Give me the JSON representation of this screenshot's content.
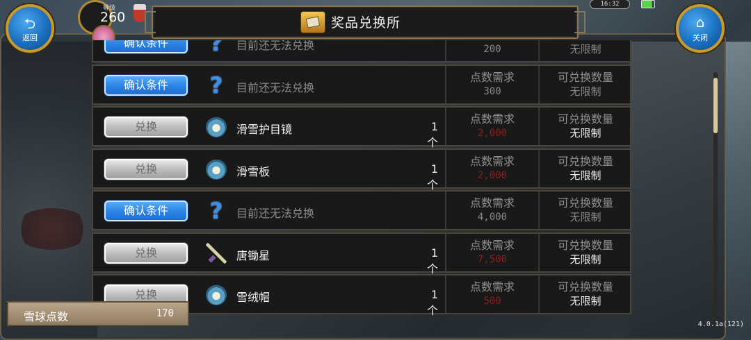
{
  "header": {
    "title": "奖品兑换所",
    "back_label": "返回",
    "close_label": "关闭",
    "level_caption": "等级",
    "level_value": "260",
    "time": "16:32"
  },
  "columns": {
    "need_header": "点数需求",
    "limit_header": "可兑换数量"
  },
  "rows": [
    {
      "action": "确认条件",
      "action_style": "blue",
      "icon": "question-icon",
      "name": "目前还无法兑换",
      "qty": "",
      "points": "200",
      "limit": "无限制",
      "available": false
    },
    {
      "action": "确认条件",
      "action_style": "blue",
      "icon": "question-icon",
      "name": "目前还无法兑换",
      "qty": "",
      "points": "300",
      "limit": "无限制",
      "available": false
    },
    {
      "action": "兑换",
      "action_style": "gray",
      "icon": "skate-shoe-icon",
      "name": "滑雪护目镜",
      "qty": "1个",
      "points": "2,000",
      "limit": "无限制",
      "available": true
    },
    {
      "action": "兑换",
      "action_style": "gray",
      "icon": "skate-shoe-icon",
      "name": "滑雪板",
      "qty": "1个",
      "points": "2,000",
      "limit": "无限制",
      "available": true
    },
    {
      "action": "确认条件",
      "action_style": "blue",
      "icon": "question-icon",
      "name": "目前还无法兑换",
      "qty": "",
      "points": "4,000",
      "limit": "无限制",
      "available": false
    },
    {
      "action": "兑换",
      "action_style": "gray",
      "icon": "sword-icon",
      "name": "唐锄星",
      "qty": "1个",
      "points": "7,500",
      "limit": "无限制",
      "available": true
    },
    {
      "action": "兑换",
      "action_style": "gray",
      "icon": "skate-shoe-icon",
      "name": "雪绒帽",
      "qty": "1个",
      "points": "500",
      "limit": "无限制",
      "available": true
    }
  ],
  "footer": {
    "points_label": "雪球点数",
    "points_value": "170",
    "version": "4.0.1a(121)"
  },
  "colors": {
    "blue_button": "#2d86e6",
    "points_unavailable": "#8e1f1f",
    "frame_gold": "#8a7650"
  }
}
